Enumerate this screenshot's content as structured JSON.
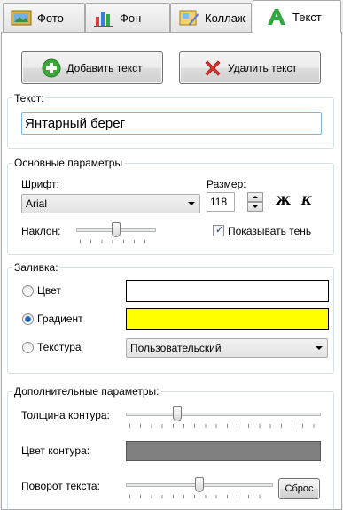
{
  "tabs": [
    {
      "label": "Фото",
      "icon": "photo-icon"
    },
    {
      "label": "Фон",
      "icon": "bar-chart-icon"
    },
    {
      "label": "Коллаж",
      "icon": "collage-icon"
    },
    {
      "label": "Текст",
      "icon": "letter-a-icon"
    }
  ],
  "active_tab": "Текст",
  "buttons": {
    "add_text": "Добавить текст",
    "delete_text": "Удалить текст",
    "reset": "Сброс"
  },
  "text_group": {
    "label": "Текст:",
    "value": "Янтарный берег"
  },
  "main_params": {
    "label": "Основные параметры",
    "font_label": "Шрифт:",
    "font_value": "Arial",
    "size_label": "Размер:",
    "size_value": "118",
    "bold_label": "Ж",
    "italic_label": "К",
    "tilt_label": "Наклон:",
    "tilt_value": 0.5,
    "shadow_label": "Показывать тень",
    "shadow_checked": true
  },
  "fill": {
    "label": "Заливка:",
    "options": [
      "Цвет",
      "Градиент",
      "Текстура"
    ],
    "selected": "Градиент",
    "color_value": "#ffffff",
    "gradient_color": "#ffff00",
    "texture_value": "Пользовательский"
  },
  "extra_params": {
    "label": "Дополнительные параметры:",
    "stroke_width_label": "Толщина контура:",
    "stroke_width_value": 0.25,
    "stroke_color_label": "Цвет контура:",
    "stroke_color": "#808080",
    "rotation_label": "Поворот текста:",
    "rotation_value": 0.5
  },
  "colors": {
    "group_border": "#d5dfe5",
    "focus_border": "#7eb4ea",
    "add_icon": "#3aa83a",
    "delete_icon": "#e0322d"
  }
}
